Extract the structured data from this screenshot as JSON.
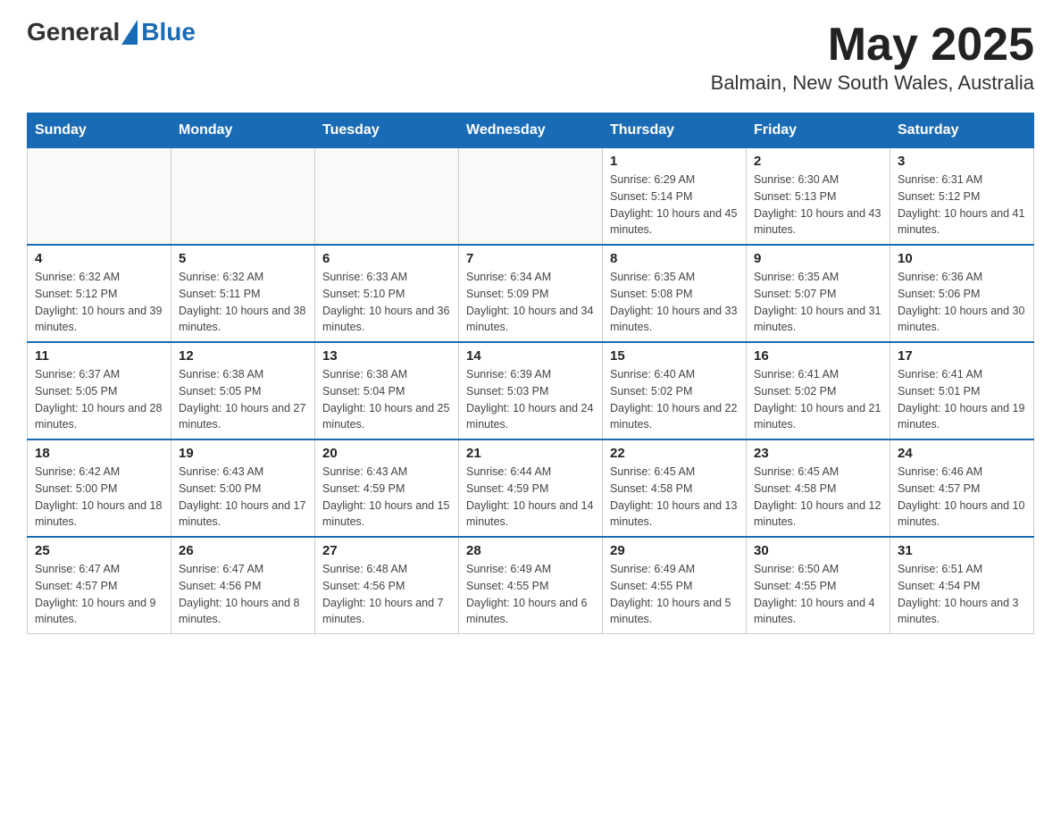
{
  "header": {
    "logo_general": "General",
    "logo_blue": "Blue",
    "title": "May 2025",
    "subtitle": "Balmain, New South Wales, Australia"
  },
  "days_of_week": [
    "Sunday",
    "Monday",
    "Tuesday",
    "Wednesday",
    "Thursday",
    "Friday",
    "Saturday"
  ],
  "weeks": [
    [
      {
        "day": "",
        "info": ""
      },
      {
        "day": "",
        "info": ""
      },
      {
        "day": "",
        "info": ""
      },
      {
        "day": "",
        "info": ""
      },
      {
        "day": "1",
        "info": "Sunrise: 6:29 AM\nSunset: 5:14 PM\nDaylight: 10 hours and 45 minutes."
      },
      {
        "day": "2",
        "info": "Sunrise: 6:30 AM\nSunset: 5:13 PM\nDaylight: 10 hours and 43 minutes."
      },
      {
        "day": "3",
        "info": "Sunrise: 6:31 AM\nSunset: 5:12 PM\nDaylight: 10 hours and 41 minutes."
      }
    ],
    [
      {
        "day": "4",
        "info": "Sunrise: 6:32 AM\nSunset: 5:12 PM\nDaylight: 10 hours and 39 minutes."
      },
      {
        "day": "5",
        "info": "Sunrise: 6:32 AM\nSunset: 5:11 PM\nDaylight: 10 hours and 38 minutes."
      },
      {
        "day": "6",
        "info": "Sunrise: 6:33 AM\nSunset: 5:10 PM\nDaylight: 10 hours and 36 minutes."
      },
      {
        "day": "7",
        "info": "Sunrise: 6:34 AM\nSunset: 5:09 PM\nDaylight: 10 hours and 34 minutes."
      },
      {
        "day": "8",
        "info": "Sunrise: 6:35 AM\nSunset: 5:08 PM\nDaylight: 10 hours and 33 minutes."
      },
      {
        "day": "9",
        "info": "Sunrise: 6:35 AM\nSunset: 5:07 PM\nDaylight: 10 hours and 31 minutes."
      },
      {
        "day": "10",
        "info": "Sunrise: 6:36 AM\nSunset: 5:06 PM\nDaylight: 10 hours and 30 minutes."
      }
    ],
    [
      {
        "day": "11",
        "info": "Sunrise: 6:37 AM\nSunset: 5:05 PM\nDaylight: 10 hours and 28 minutes."
      },
      {
        "day": "12",
        "info": "Sunrise: 6:38 AM\nSunset: 5:05 PM\nDaylight: 10 hours and 27 minutes."
      },
      {
        "day": "13",
        "info": "Sunrise: 6:38 AM\nSunset: 5:04 PM\nDaylight: 10 hours and 25 minutes."
      },
      {
        "day": "14",
        "info": "Sunrise: 6:39 AM\nSunset: 5:03 PM\nDaylight: 10 hours and 24 minutes."
      },
      {
        "day": "15",
        "info": "Sunrise: 6:40 AM\nSunset: 5:02 PM\nDaylight: 10 hours and 22 minutes."
      },
      {
        "day": "16",
        "info": "Sunrise: 6:41 AM\nSunset: 5:02 PM\nDaylight: 10 hours and 21 minutes."
      },
      {
        "day": "17",
        "info": "Sunrise: 6:41 AM\nSunset: 5:01 PM\nDaylight: 10 hours and 19 minutes."
      }
    ],
    [
      {
        "day": "18",
        "info": "Sunrise: 6:42 AM\nSunset: 5:00 PM\nDaylight: 10 hours and 18 minutes."
      },
      {
        "day": "19",
        "info": "Sunrise: 6:43 AM\nSunset: 5:00 PM\nDaylight: 10 hours and 17 minutes."
      },
      {
        "day": "20",
        "info": "Sunrise: 6:43 AM\nSunset: 4:59 PM\nDaylight: 10 hours and 15 minutes."
      },
      {
        "day": "21",
        "info": "Sunrise: 6:44 AM\nSunset: 4:59 PM\nDaylight: 10 hours and 14 minutes."
      },
      {
        "day": "22",
        "info": "Sunrise: 6:45 AM\nSunset: 4:58 PM\nDaylight: 10 hours and 13 minutes."
      },
      {
        "day": "23",
        "info": "Sunrise: 6:45 AM\nSunset: 4:58 PM\nDaylight: 10 hours and 12 minutes."
      },
      {
        "day": "24",
        "info": "Sunrise: 6:46 AM\nSunset: 4:57 PM\nDaylight: 10 hours and 10 minutes."
      }
    ],
    [
      {
        "day": "25",
        "info": "Sunrise: 6:47 AM\nSunset: 4:57 PM\nDaylight: 10 hours and 9 minutes."
      },
      {
        "day": "26",
        "info": "Sunrise: 6:47 AM\nSunset: 4:56 PM\nDaylight: 10 hours and 8 minutes."
      },
      {
        "day": "27",
        "info": "Sunrise: 6:48 AM\nSunset: 4:56 PM\nDaylight: 10 hours and 7 minutes."
      },
      {
        "day": "28",
        "info": "Sunrise: 6:49 AM\nSunset: 4:55 PM\nDaylight: 10 hours and 6 minutes."
      },
      {
        "day": "29",
        "info": "Sunrise: 6:49 AM\nSunset: 4:55 PM\nDaylight: 10 hours and 5 minutes."
      },
      {
        "day": "30",
        "info": "Sunrise: 6:50 AM\nSunset: 4:55 PM\nDaylight: 10 hours and 4 minutes."
      },
      {
        "day": "31",
        "info": "Sunrise: 6:51 AM\nSunset: 4:54 PM\nDaylight: 10 hours and 3 minutes."
      }
    ]
  ]
}
